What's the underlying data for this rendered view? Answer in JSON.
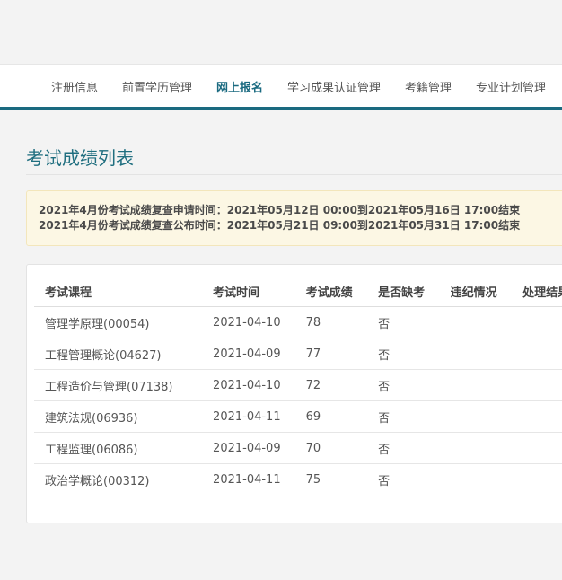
{
  "nav": {
    "items": [
      {
        "label": "注册信息"
      },
      {
        "label": "前置学历管理"
      },
      {
        "label": "网上报名"
      },
      {
        "label": "学习成果认证管理"
      },
      {
        "label": "考籍管理"
      },
      {
        "label": "专业计划管理"
      }
    ],
    "active_index": 2
  },
  "page": {
    "title": "考试成绩列表"
  },
  "notice": {
    "lines": [
      "2021年4月份考试成绩复查申请时间：2021年05月12日 00:00到2021年05月16日 17:00结束",
      "2021年4月份考试成绩复查公布时间：2021年05月21日 09:00到2021年05月31日 17:00结束"
    ]
  },
  "table": {
    "headers": [
      "考试课程",
      "考试时间",
      "考试成绩",
      "是否缺考",
      "违纪情况",
      "处理结果"
    ],
    "rows": [
      [
        "管理学原理(00054)",
        "2021-04-10",
        "78",
        "否",
        "",
        ""
      ],
      [
        "工程管理概论(04627)",
        "2021-04-09",
        "77",
        "否",
        "",
        ""
      ],
      [
        "工程造价与管理(07138)",
        "2021-04-10",
        "72",
        "否",
        "",
        ""
      ],
      [
        "建筑法规(06936)",
        "2021-04-11",
        "69",
        "否",
        "",
        ""
      ],
      [
        "工程监理(06086)",
        "2021-04-09",
        "70",
        "否",
        "",
        ""
      ],
      [
        "政治学概论(00312)",
        "2021-04-11",
        "75",
        "否",
        "",
        ""
      ]
    ]
  },
  "colors": {
    "accent": "#1a6a80",
    "title": "#1f6e7f",
    "notice_bg": "#fcf7e4"
  }
}
